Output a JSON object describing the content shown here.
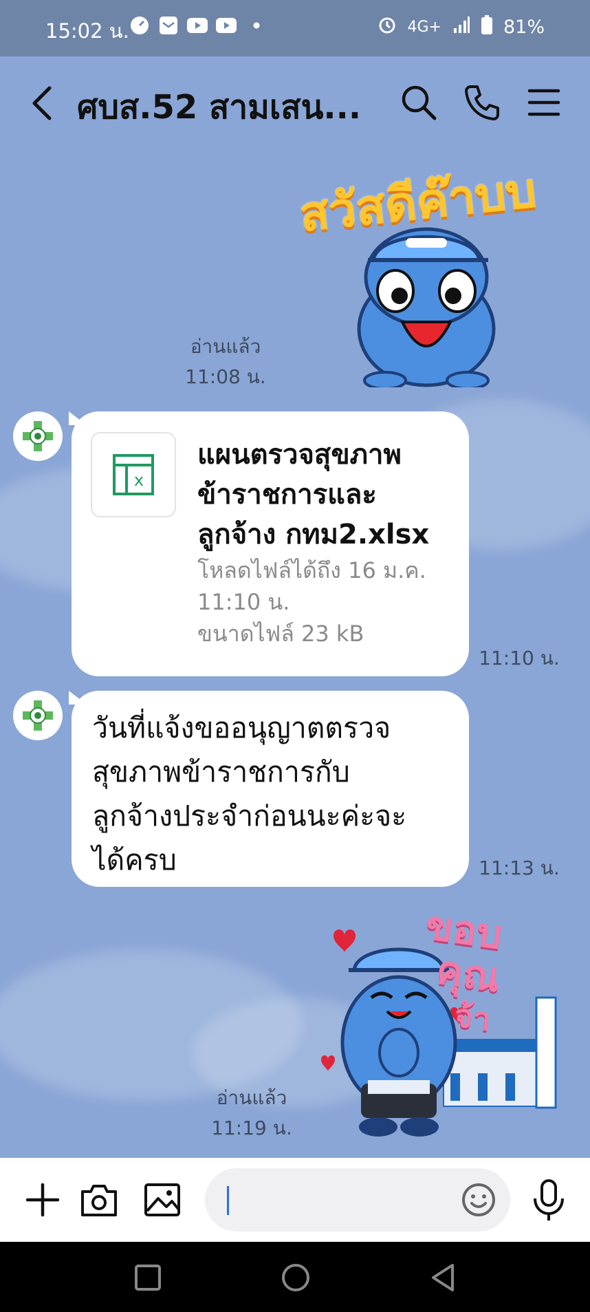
{
  "status_bar": {
    "time": "15:02 น.",
    "network": "4G+",
    "battery": "81%"
  },
  "header": {
    "title": "ศบส.52 สามเสน...",
    "back_icon": "chevron-left-icon",
    "search_icon": "search-icon",
    "call_icon": "phone-icon",
    "menu_icon": "menu-icon"
  },
  "messages": [
    {
      "type": "sticker",
      "side": "right",
      "sticker_text": "สวัสดีค๊าบบ",
      "read_label": "อ่านแล้ว",
      "time": "11:08 น."
    },
    {
      "type": "file",
      "side": "left",
      "file_name": "แผนตรวจสุขภาพข้าราชการและลูกจ้าง กทม2.xlsx",
      "file_name_lines": [
        "แผนตรวจสุขภาพ",
        "ข้าราชการและ",
        "ลูกจ้าง กทม2.xlsx"
      ],
      "download_until_lines": [
        "โหลดไฟล์ได้ถึง 16 ม.ค.",
        "11:10 น."
      ],
      "file_size": "ขนาดไฟล์ 23 kB",
      "file_icon_letter": "x",
      "time": "11:10 น."
    },
    {
      "type": "text",
      "side": "left",
      "text_lines": [
        "วันที่แจ้งขออนุญาตตรวจ",
        "สุขภาพข้าราชการกับ",
        "ลูกจ้างประจำก่อนนะค่ะจะ",
        "ได้ครบ"
      ],
      "time": "11:13 น."
    },
    {
      "type": "sticker",
      "side": "right",
      "sticker_text": [
        "ขอบ",
        "คุณ",
        "จ้า"
      ],
      "read_label": "อ่านแล้ว",
      "time": "11:19 น."
    }
  ],
  "input_bar": {
    "plus_icon": "plus-icon",
    "camera_icon": "camera-icon",
    "image_icon": "image-icon",
    "emoji_icon": "emoji-icon",
    "mic_icon": "microphone-icon",
    "value": ""
  },
  "nav_bar": {
    "recents_icon": "square-icon",
    "home_icon": "circle-icon",
    "back_icon": "triangle-back-icon"
  },
  "colors": {
    "chat_background": "#8aa6d6",
    "status_bar": "#6f85a7",
    "bubble": "#ffffff",
    "sticker_yellow": "#ffc62e",
    "sticker_pink": "#f07aa8",
    "dino_blue": "#4c8fe0",
    "caret": "#2d6be6",
    "excel_green": "#1e9a62"
  }
}
